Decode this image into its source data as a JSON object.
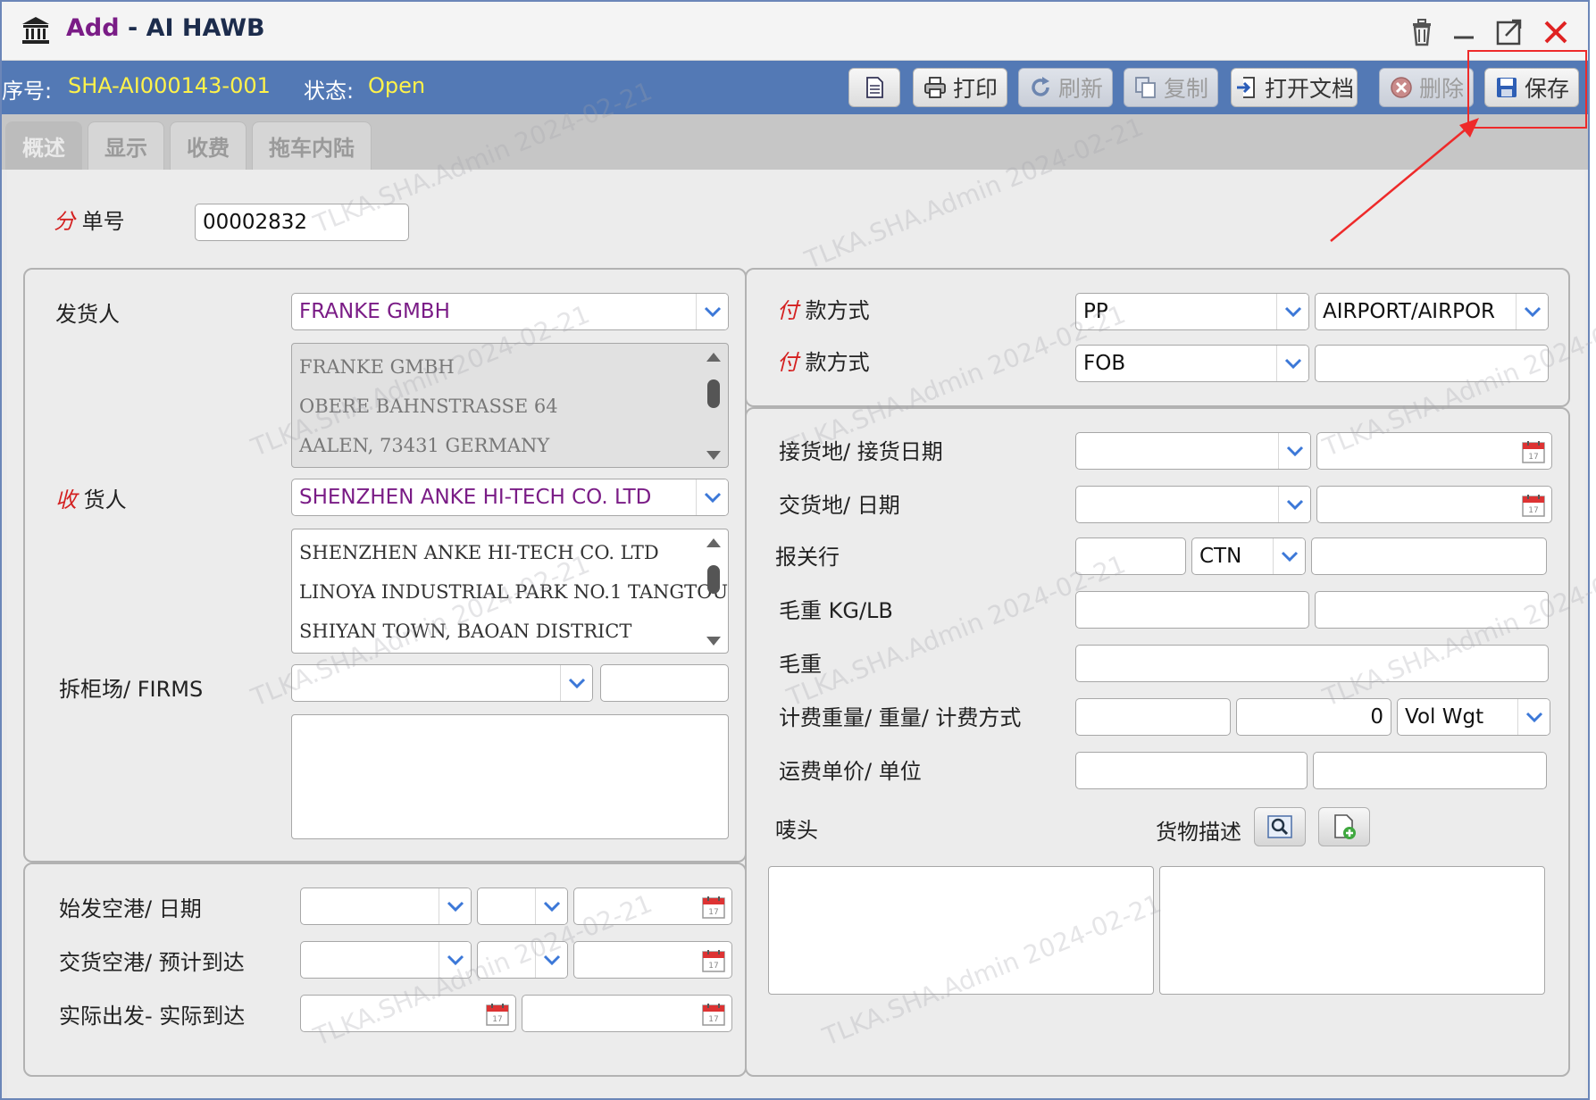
{
  "window": {
    "title_mode": "Add",
    "title_separator": " - ",
    "title_name": "AI HAWB"
  },
  "record": {
    "seq_label": "序号:",
    "seq_value": "SHA-AI000143-001",
    "status_label": "状态:",
    "status_value": "Open"
  },
  "toolbar": {
    "print": "打印",
    "refresh": "刷新",
    "copy": "复制",
    "open_doc": "打开文档",
    "delete": "删除",
    "save": "保存"
  },
  "tabs": [
    "概述",
    "显示",
    "收费",
    "拖车内陆"
  ],
  "hawb": {
    "label_req": "分",
    "label_rest": "单号",
    "value": "00002832"
  },
  "shipper": {
    "label": "发货人",
    "value": "FRANKE GMBH",
    "address": [
      "FRANKE GMBH",
      "OBERE BAHNSTRASSE 64",
      "AALEN, 73431 GERMANY"
    ]
  },
  "consignee": {
    "label_req": "收",
    "label_rest": "货人",
    "value": "SHENZHEN ANKE HI-TECH CO. LTD",
    "address": [
      "SHENZHEN ANKE HI-TECH CO. LTD",
      "LINOYA INDUSTRIAL PARK NO.1 TANGTOU",
      "SHIYAN TOWN, BAOAN DISTRICT"
    ]
  },
  "firms": {
    "label": "拆柜场/ FIRMS"
  },
  "ports": {
    "departure": "始发空港/ 日期",
    "destination": "交货空港/ 预计到达",
    "actual": "实际出发- 实际到达"
  },
  "payment": {
    "label1_req": "付",
    "label1_rest": "款方式",
    "pp": "PP",
    "terms": "AIRPORT/AIRPOR",
    "label2_req": "付",
    "label2_rest": "款方式",
    "incoterm": "FOB"
  },
  "cargo": {
    "receipt": "接货地/ 接货日期",
    "delivery": "交货地/ 日期",
    "broker": "报关行",
    "unit": "CTN",
    "gross_kg_lb": "毛重  KG/LB",
    "gross": "毛重",
    "chargeable": "计费重量/  重量/  计费方式",
    "weight_value": "0",
    "charge_method": "Vol Wgt",
    "rate": "运费单价/ 单位",
    "marks": "唛头",
    "description": "货物描述"
  },
  "watermark": "TLKA.SHA.Admin 2024-02-21",
  "colors": {
    "toolbar_bg": "#5379b5",
    "highlight_value": "#fff24a",
    "purple_text": "#7a1c86",
    "required": "#d42020",
    "annotation": "#ee2a2a"
  }
}
